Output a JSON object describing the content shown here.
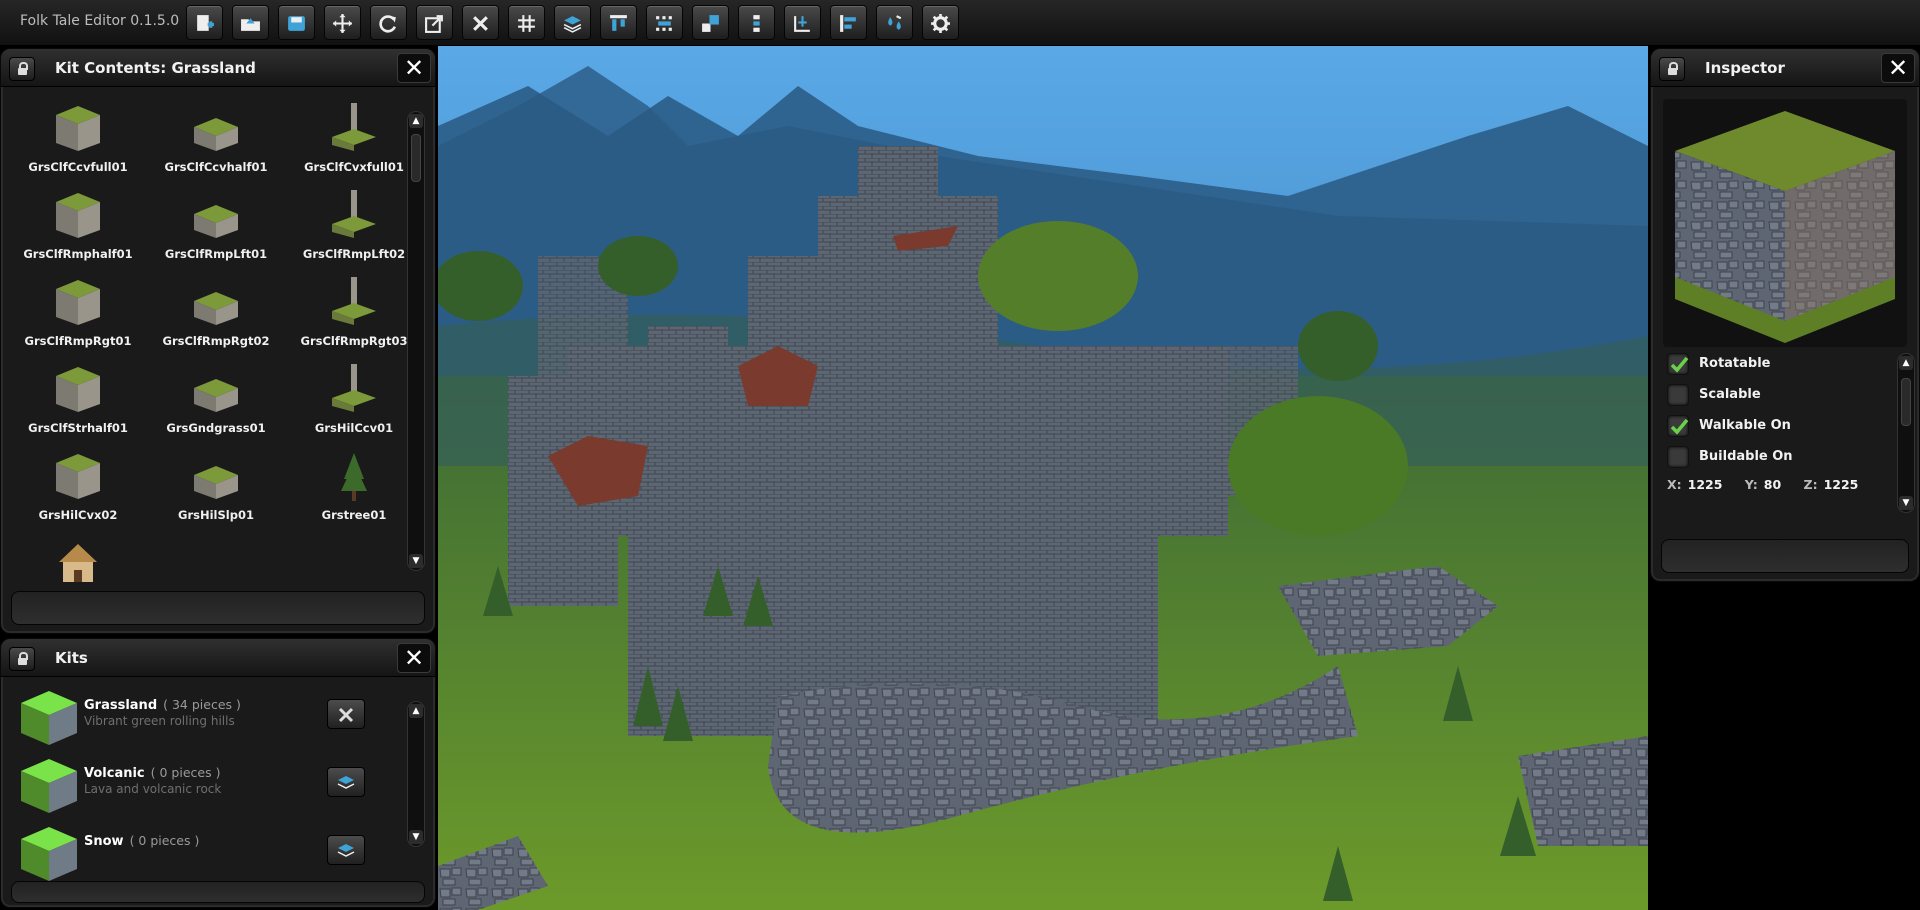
{
  "app": {
    "title": "Folk Tale Editor 0.1.5.0"
  },
  "toolbar": {
    "buttons": [
      "new-map",
      "open-map",
      "save-map",
      "move-tool",
      "rotate-tool",
      "scale-tool",
      "delete-tool",
      "grid-toggle",
      "layers",
      "align-top",
      "distribute",
      "snap-pieces",
      "group-pieces",
      "pivot-tool",
      "align-left",
      "paint-tool",
      "settings"
    ]
  },
  "kit_contents": {
    "title": "Kit Contents: Grassland",
    "items": [
      "GrsClfCcvfull01",
      "GrsClfCcvhalf01",
      "GrsClfCvxfull01",
      "GrsClfRmphalf01",
      "GrsClfRmpLft01",
      "GrsClfRmpLft02",
      "GrsClfRmpRgt01",
      "GrsClfRmpRgt02",
      "GrsClfRmpRgt03",
      "GrsClfStrhalf01",
      "GrsGndgrass01",
      "GrsHilCcv01",
      "GrsHilCvx02",
      "GrsHilSlp01",
      "Grstree01",
      ""
    ]
  },
  "kits": {
    "title": "Kits",
    "items": [
      {
        "name": "Grassland",
        "count": "( 34 pieces )",
        "description": "Vibrant green rolling hills",
        "action": "delete"
      },
      {
        "name": "Volcanic",
        "count": "( 0 pieces )",
        "description": "Lava and volcanic rock",
        "action": "load"
      },
      {
        "name": "Snow",
        "count": "( 0 pieces )",
        "description": "",
        "action": "load"
      }
    ]
  },
  "inspector": {
    "title": "Inspector",
    "properties": [
      {
        "label": "Rotatable",
        "checked": true
      },
      {
        "label": "Scalable",
        "checked": false
      },
      {
        "label": "Walkable On",
        "checked": true
      },
      {
        "label": "Buildable On",
        "checked": false
      }
    ],
    "coords": {
      "x_label": "X:",
      "x": "1225",
      "y_label": "Y:",
      "y": "80",
      "z_label": "Z:",
      "z": "1225"
    }
  },
  "colors": {
    "accent": "#3fa3d8",
    "check": "#6ad24a",
    "sky": "#4f9fd9",
    "grass": "#5b8a2c",
    "stone": "#5a6470"
  }
}
